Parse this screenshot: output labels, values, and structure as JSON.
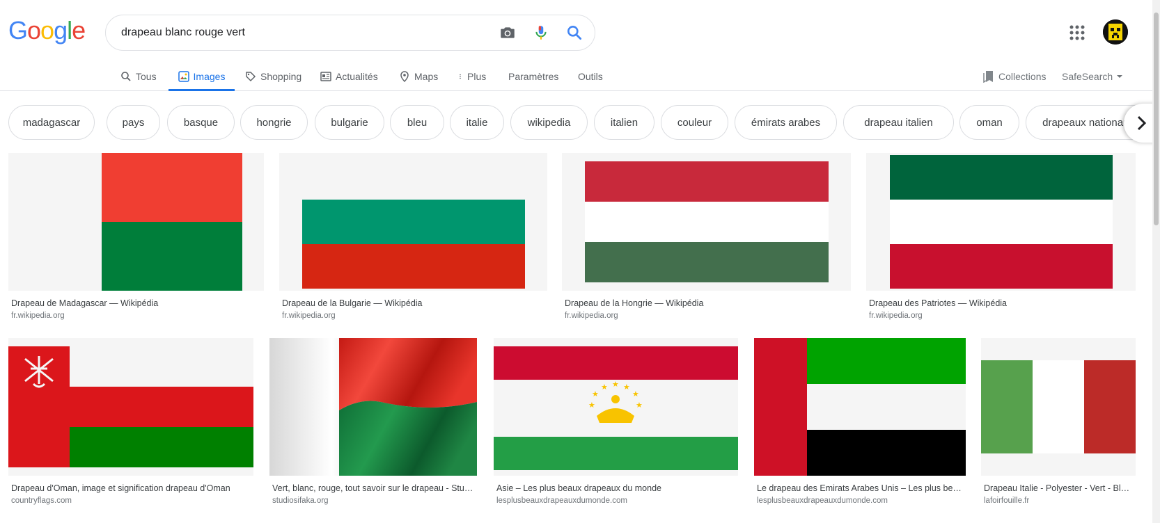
{
  "search": {
    "query": "drapeau blanc rouge vert"
  },
  "logo": {
    "letters": [
      "G",
      "o",
      "o",
      "g",
      "l",
      "e"
    ]
  },
  "nav": {
    "tabs": [
      {
        "label": "Tous",
        "icon": "search-icon"
      },
      {
        "label": "Images",
        "icon": "image-icon",
        "active": true
      },
      {
        "label": "Shopping",
        "icon": "tag-icon"
      },
      {
        "label": "Actualités",
        "icon": "news-icon"
      },
      {
        "label": "Maps",
        "icon": "map-pin-icon"
      },
      {
        "label": "Plus",
        "icon": "more-vert-icon"
      },
      {
        "label": "Paramètres"
      },
      {
        "label": "Outils"
      }
    ],
    "collections": "Collections",
    "safesearch": "SafeSearch"
  },
  "chips": [
    "madagascar",
    "pays",
    "basque",
    "hongrie",
    "bulgarie",
    "bleu",
    "italie",
    "wikipedia",
    "italien",
    "couleur",
    "émirats arabes",
    "drapeau italien",
    "oman",
    "drapeaux nationaux"
  ],
  "results": [
    {
      "title": "Drapeau de Madagascar — Wikipédia",
      "source": "fr.wikipedia.org",
      "flag": "madagascar"
    },
    {
      "title": "Drapeau de la Bulgarie — Wikipédia",
      "source": "fr.wikipedia.org",
      "flag": "bulgaria"
    },
    {
      "title": "Drapeau de la Hongrie — Wikipédia",
      "source": "fr.wikipedia.org",
      "flag": "hungary"
    },
    {
      "title": "Drapeau des Patriotes — Wikipédia",
      "source": "fr.wikipedia.org",
      "flag": "patriotes"
    },
    {
      "title": "Drapeau d'Oman, image et signification drapeau d'Oman",
      "source": "countryflags.com",
      "flag": "oman"
    },
    {
      "title": "Vert, blanc, rouge, tout savoir sur le drapeau - Studio Sifaka",
      "source": "studiosifaka.org",
      "flag": "madagascar-wave"
    },
    {
      "title": "Asie – Les plus beaux drapeaux du monde",
      "source": "lesplusbeauxdrapeauxdumonde.com",
      "flag": "tajikistan"
    },
    {
      "title": "Le drapeau des Emirats Arabes Unis – Les plus beaux drapeaux",
      "source": "lesplusbeauxdrapeauxdumonde.com",
      "flag": "uae"
    },
    {
      "title": "Drapeau Italie - Polyester - Vert - Blanc - Rouge",
      "source": "lafoirfouille.fr",
      "flag": "italy"
    }
  ],
  "colors": {
    "accent": "#1a73e8",
    "mg_red": "#f03e32",
    "mg_green": "#007e3a",
    "bg_green": "#00966e",
    "bg_red": "#d62612",
    "hu_red": "#c8293b",
    "hu_green": "#436f4d",
    "pt_green": "#00643c",
    "pt_red": "#c8102e",
    "om_red": "#db161b",
    "om_green": "#008000",
    "tj_red": "#cc0c30",
    "tj_green": "#239e46",
    "tj_gold": "#f8c300",
    "ae_red": "#ce1126",
    "ae_green": "#00a300",
    "it_green": "#57a14d",
    "it_red": "#bc2b28"
  }
}
